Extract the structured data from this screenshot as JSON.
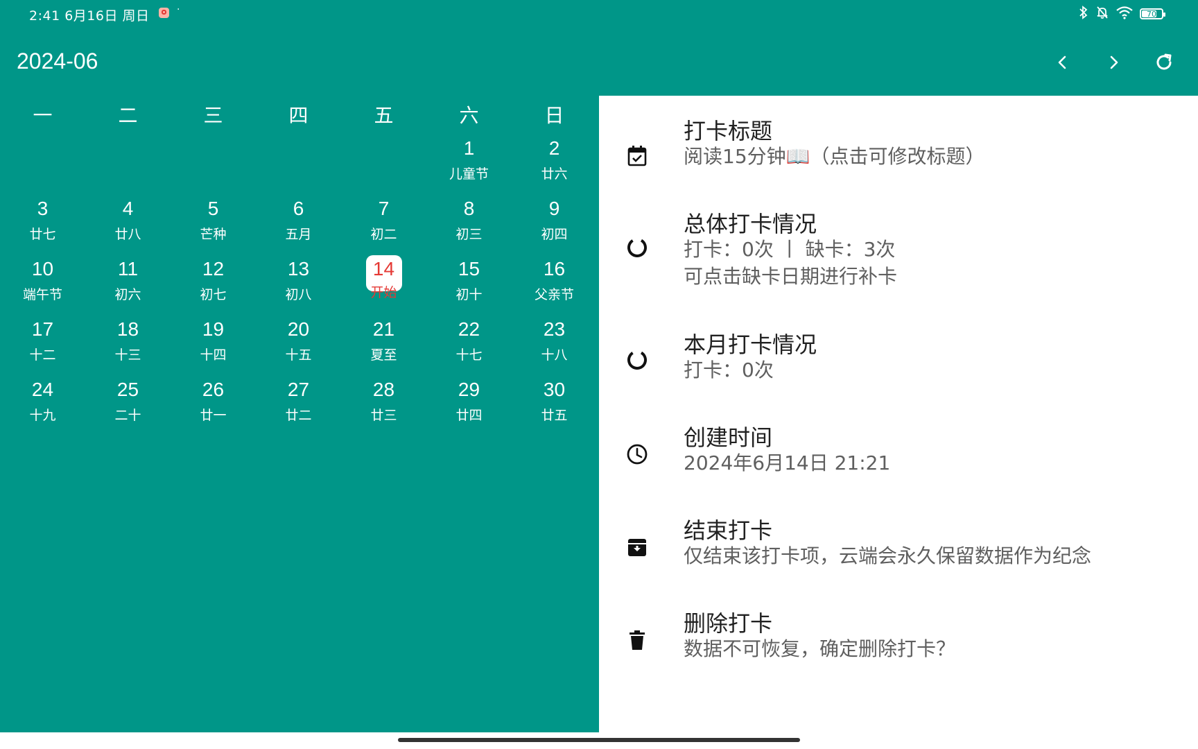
{
  "status_bar": {
    "time_date": "2:41  6月16日  周日",
    "dot": "·",
    "battery": "70"
  },
  "app_bar": {
    "title": "2024-06",
    "prev_icon": "chevron-left-icon",
    "next_icon": "chevron-right-icon",
    "refresh_icon": "refresh-icon"
  },
  "calendar": {
    "weekdays": [
      "一",
      "二",
      "三",
      "四",
      "五",
      "六",
      "日"
    ],
    "weeks": [
      [
        null,
        null,
        null,
        null,
        null,
        {
          "num": "1",
          "sub": "儿童节"
        },
        {
          "num": "2",
          "sub": "廿六"
        }
      ],
      [
        {
          "num": "3",
          "sub": "廿七"
        },
        {
          "num": "4",
          "sub": "廿八"
        },
        {
          "num": "5",
          "sub": "芒种"
        },
        {
          "num": "6",
          "sub": "五月"
        },
        {
          "num": "7",
          "sub": "初二"
        },
        {
          "num": "8",
          "sub": "初三"
        },
        {
          "num": "9",
          "sub": "初四"
        }
      ],
      [
        {
          "num": "10",
          "sub": "端午节"
        },
        {
          "num": "11",
          "sub": "初六"
        },
        {
          "num": "12",
          "sub": "初七"
        },
        {
          "num": "13",
          "sub": "初八"
        },
        {
          "num": "14",
          "sub": "开始",
          "today": true
        },
        {
          "num": "15",
          "sub": "初十"
        },
        {
          "num": "16",
          "sub": "父亲节"
        }
      ],
      [
        {
          "num": "17",
          "sub": "十二"
        },
        {
          "num": "18",
          "sub": "十三"
        },
        {
          "num": "19",
          "sub": "十四"
        },
        {
          "num": "20",
          "sub": "十五"
        },
        {
          "num": "21",
          "sub": "夏至"
        },
        {
          "num": "22",
          "sub": "十七"
        },
        {
          "num": "23",
          "sub": "十八"
        }
      ],
      [
        {
          "num": "24",
          "sub": "十九"
        },
        {
          "num": "25",
          "sub": "二十"
        },
        {
          "num": "26",
          "sub": "廿一"
        },
        {
          "num": "27",
          "sub": "廿二"
        },
        {
          "num": "28",
          "sub": "廿三"
        },
        {
          "num": "29",
          "sub": "廿四"
        },
        {
          "num": "30",
          "sub": "廿五"
        }
      ]
    ]
  },
  "details": {
    "title_item": {
      "label": "打卡标题",
      "sub": "阅读15分钟📖（点击可修改标题）",
      "icon": "calendar-check-icon"
    },
    "overall_item": {
      "label": "总体打卡情况",
      "sub1": "打卡：0次  丨  缺卡：3次",
      "sub2": "可点击缺卡日期进行补卡",
      "icon": "progress-ring-icon"
    },
    "month_item": {
      "label": "本月打卡情况",
      "sub": "打卡：0次",
      "icon": "progress-ring-icon"
    },
    "created_item": {
      "label": "创建时间",
      "sub": "2024年6月14日 21:21",
      "icon": "clock-icon"
    },
    "end_item": {
      "label": "结束打卡",
      "sub": "仅结束该打卡项，云端会永久保留数据作为纪念",
      "icon": "archive-icon"
    },
    "delete_item": {
      "label": "删除打卡",
      "sub": "数据不可恢复，确定删除打卡？",
      "icon": "trash-icon"
    }
  },
  "colors": {
    "primary": "#009688",
    "today_accent": "#e53935"
  }
}
